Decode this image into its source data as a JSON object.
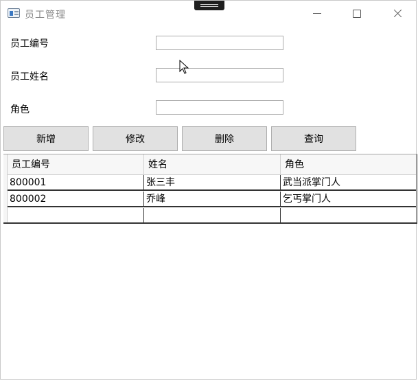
{
  "window": {
    "title": "员工管理",
    "icons": {
      "app": "window-app-icon",
      "minimize": "minimize-icon",
      "maximize": "maximize-icon",
      "close": "close-icon"
    }
  },
  "form": {
    "employee_id_label": "员工编号",
    "employee_id_value": "",
    "name_label": "员工姓名",
    "name_value": "",
    "role_label": "角色",
    "role_value": ""
  },
  "toolbar": {
    "add_label": "新增",
    "edit_label": "修改",
    "delete_label": "删除",
    "query_label": "查询"
  },
  "grid": {
    "columns": [
      "员工编号",
      "姓名",
      "角色"
    ],
    "rows": [
      [
        "800001",
        "张三丰",
        "武当派掌门人"
      ],
      [
        "800002",
        "乔峰",
        "乞丐掌门人"
      ],
      [
        "",
        "",
        ""
      ]
    ]
  },
  "colors": {
    "button_bg": "#e1e1e1",
    "title_text": "#8a8a8a",
    "grid_border": "#333333"
  }
}
